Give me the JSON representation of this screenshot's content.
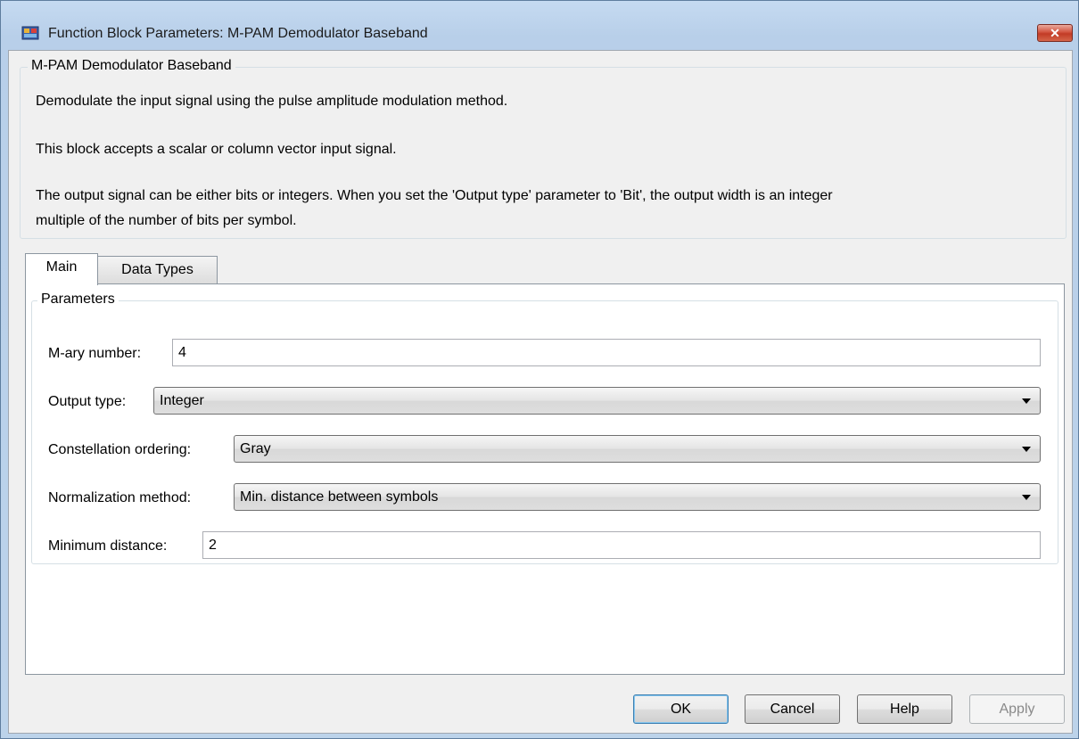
{
  "window": {
    "title": "Function Block Parameters: M-PAM Demodulator Baseband",
    "close_label": "✕"
  },
  "description": {
    "group_title": "M-PAM Demodulator Baseband",
    "line1": "Demodulate the input signal using the pulse amplitude modulation method.",
    "line2": "This block accepts a scalar or column vector input signal.",
    "line3a": "The output signal can be either bits or integers. When you set the 'Output type' parameter to 'Bit', the output width is an integer",
    "line3b": "multiple of the number of bits per symbol."
  },
  "tabs": [
    {
      "label": "Main",
      "selected": true
    },
    {
      "label": "Data Types",
      "selected": false
    }
  ],
  "parameters": {
    "group_title": "Parameters",
    "mary_label": "M-ary number:",
    "mary_value": "4",
    "output_type_label": "Output type:",
    "output_type_value": "Integer",
    "constellation_label": "Constellation ordering:",
    "constellation_value": "Gray",
    "normalization_label": "Normalization method:",
    "normalization_value": "Min. distance between symbols",
    "min_distance_label": "Minimum distance:",
    "min_distance_value": "2"
  },
  "buttons": {
    "ok": "OK",
    "cancel": "Cancel",
    "help": "Help",
    "apply": "Apply"
  }
}
